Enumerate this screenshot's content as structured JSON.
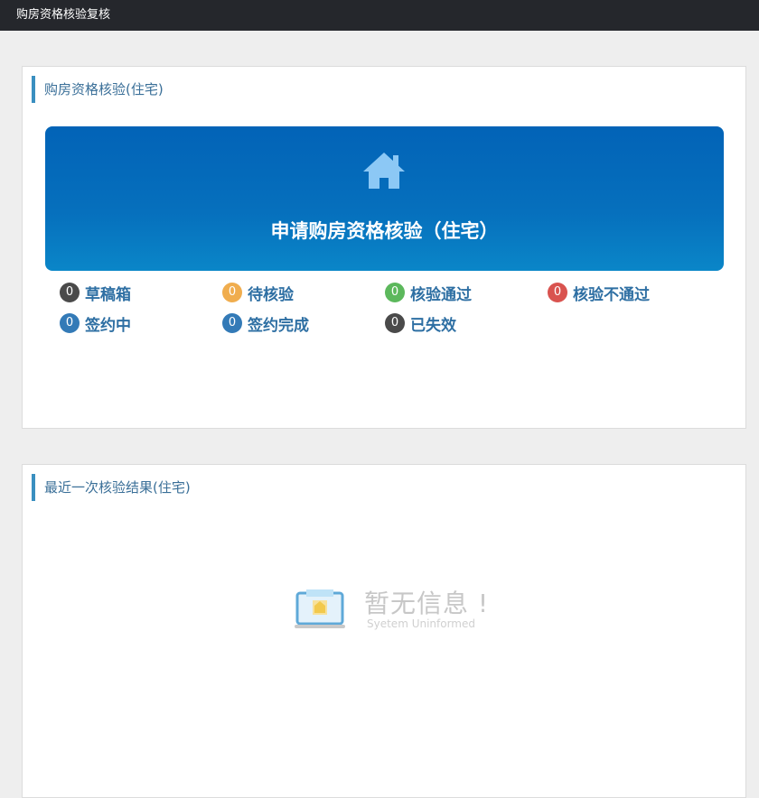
{
  "header": {
    "title": "购房资格核验复核"
  },
  "panel1": {
    "title": "购房资格核验(住宅)",
    "banner": {
      "icon": "home-icon",
      "label": "申请购房资格核验（住宅）"
    },
    "statuses": [
      {
        "count": "0",
        "label": "草稿箱",
        "color": "#4a4a4a"
      },
      {
        "count": "0",
        "label": "待核验",
        "color": "#f0ad4e"
      },
      {
        "count": "0",
        "label": "核验通过",
        "color": "#5cb85c"
      },
      {
        "count": "0",
        "label": "核验不通过",
        "color": "#d9534f"
      },
      {
        "count": "0",
        "label": "签约中",
        "color": "#337ab7"
      },
      {
        "count": "0",
        "label": "签约完成",
        "color": "#337ab7"
      },
      {
        "count": "0",
        "label": "已失效",
        "color": "#4a4a4a"
      }
    ]
  },
  "panel2": {
    "title": "最近一次核验结果(住宅)",
    "empty": {
      "icon": "empty-laptop-icon",
      "title": "暂无信息 !",
      "subtitle": "Syetem Uninformed"
    }
  }
}
